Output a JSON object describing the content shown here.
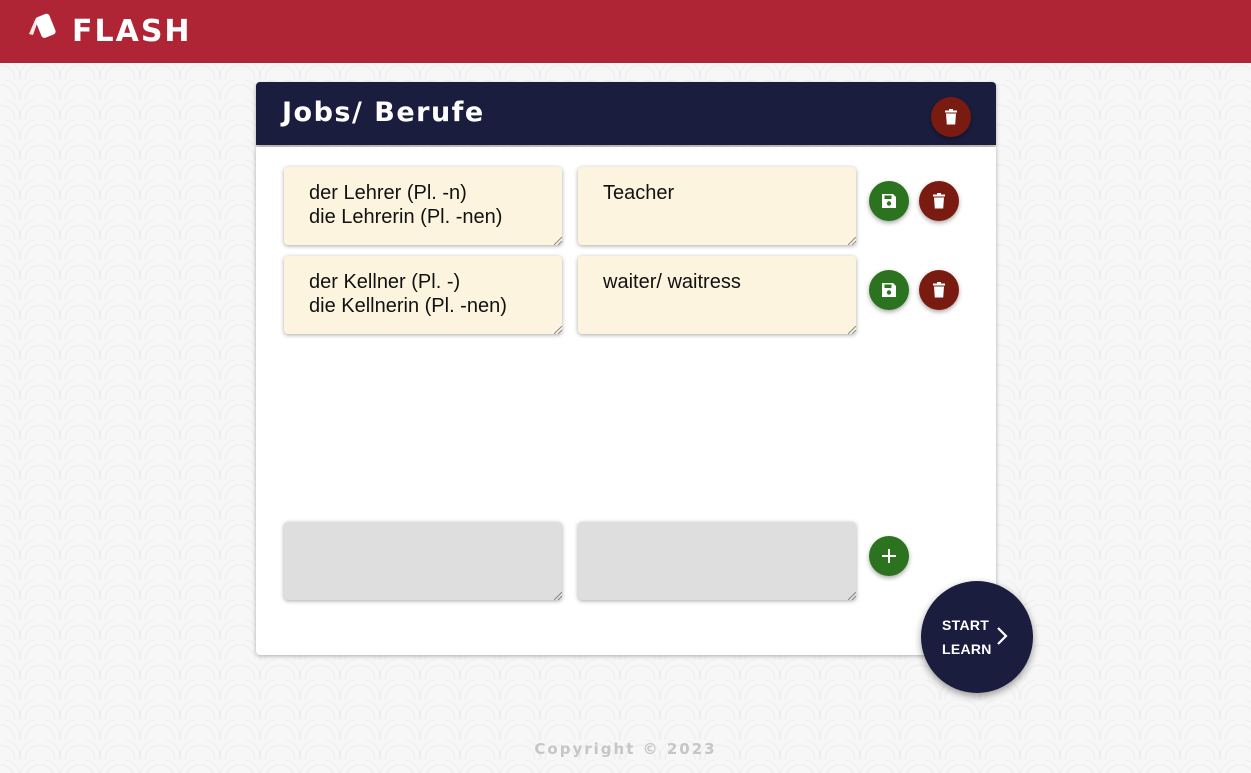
{
  "app": {
    "name": "FLASH",
    "brand_color": "#b02535",
    "logo_icon": "cards-icon"
  },
  "deck": {
    "title": "Jobs/ Berufe",
    "header_color": "#1a1d3e",
    "delete_icon": "trash-icon"
  },
  "cards": [
    {
      "front": "der Lehrer (Pl. -n)\ndie Lehrerin (Pl. -nen)",
      "back": "Teacher"
    },
    {
      "front": "der Kellner (Pl. -)\ndie Kellnerin (Pl. -nen)",
      "back": "waiter/ waitress"
    }
  ],
  "new_card": {
    "front": "",
    "back": ""
  },
  "icons": {
    "save": "save-icon",
    "delete": "trash-icon",
    "add": "plus-icon",
    "next": "chevron-right-icon"
  },
  "colors": {
    "save": "#2b731f",
    "delete": "#7a1b11",
    "card_bg": "#fcf4df",
    "empty_bg": "#dedede"
  },
  "start_button": {
    "label": "START\nLEARN"
  },
  "footer": {
    "copyright": "Copyright © 2023"
  }
}
